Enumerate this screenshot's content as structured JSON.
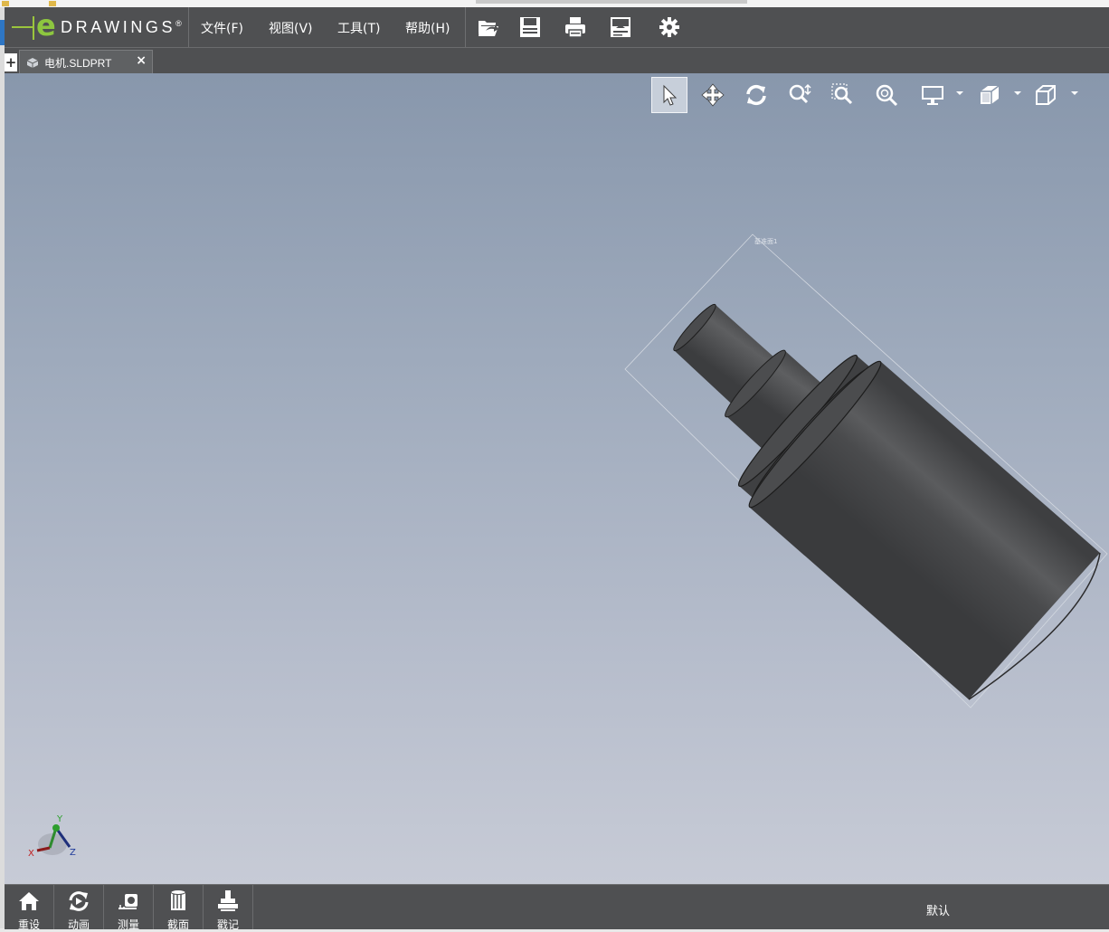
{
  "app": {
    "logo_letter": "e",
    "logo_word": "DRAWINGS",
    "logo_mark": "®"
  },
  "menu": [
    "文件(F)",
    "视图(V)",
    "工具(T)",
    "帮助(H)"
  ],
  "toolbar_icons": [
    "open-icon",
    "save-icon",
    "print-icon",
    "markup-icon",
    "gear-icon"
  ],
  "tab": {
    "label": "电机.SLDPRT",
    "close": "×",
    "add": "+"
  },
  "view_tools": [
    "select-icon",
    "pan-icon",
    "rotate-icon",
    "zoom-icon",
    "zoom-to-area-icon",
    "zoom-to-fit-icon",
    "display-icon",
    "view-orientation-icon",
    "display-style-icon"
  ],
  "model": {
    "bbox_label": "基准面1"
  },
  "triad": {
    "x": "X",
    "y": "Y",
    "z": "Z"
  },
  "bottom": {
    "buttons": [
      {
        "label": "重设",
        "icon": "home-icon"
      },
      {
        "label": "动画",
        "icon": "animate-icon"
      },
      {
        "label": "测量",
        "icon": "measure-icon"
      },
      {
        "label": "截面",
        "icon": "section-icon"
      },
      {
        "label": "戳记",
        "icon": "stamp-icon"
      }
    ],
    "configuration": "默认"
  },
  "colors": {
    "chrome": "#4f5052",
    "accent": "#8dc63f",
    "model": "#4a4b4d"
  }
}
